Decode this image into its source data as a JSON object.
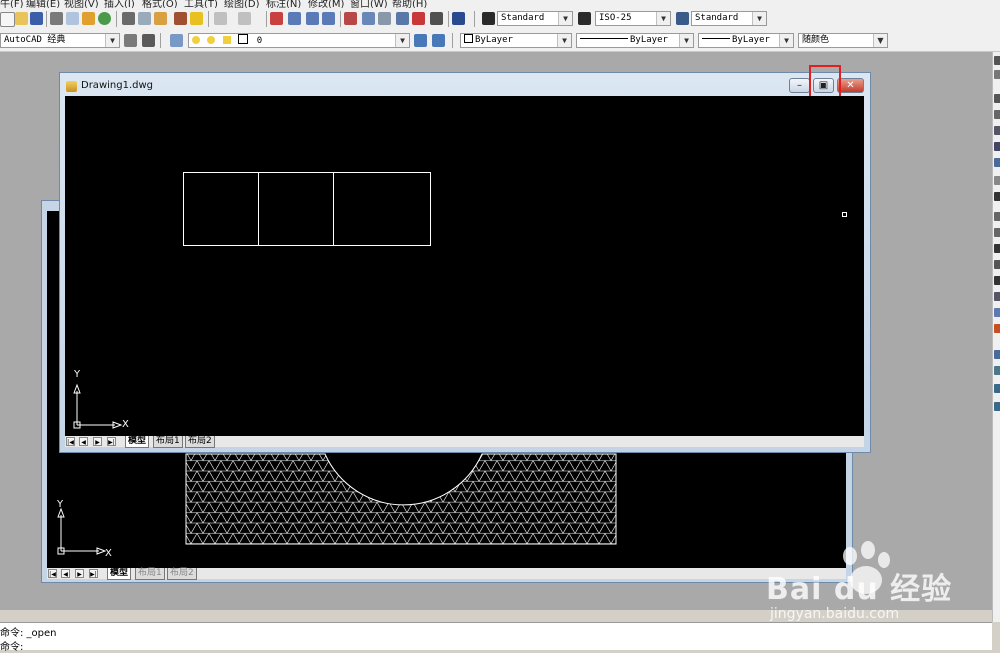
{
  "menu": {
    "items": [
      {
        "label": "牛(F)"
      },
      {
        "label": "编辑(E)"
      },
      {
        "label": "视图(V)"
      },
      {
        "label": "插入(I)"
      },
      {
        "label": "格式(O)"
      },
      {
        "label": "工具(T)"
      },
      {
        "label": "绘图(D)"
      },
      {
        "label": "标注(N)"
      },
      {
        "label": "修改(M)"
      },
      {
        "label": "窗口(W)"
      },
      {
        "label": "帮助(H)"
      }
    ]
  },
  "toolbar1": {
    "text_style": "Standard",
    "dim_style": "ISO-25",
    "table_style": "Standard"
  },
  "toolbar2": {
    "workspace": "AutoCAD 经典",
    "layer": "0",
    "color": "ByLayer",
    "linetype": "ByLayer",
    "lineweight": "ByLayer",
    "plotstyle": "随颜色"
  },
  "front_window": {
    "title": "Drawing1.dwg",
    "tabs": [
      "模型",
      "布局1",
      "布局2"
    ],
    "ucs_x": "X",
    "ucs_y": "Y",
    "btn_min": "–",
    "btn_restore": "▣",
    "btn_close": "✕"
  },
  "back_window": {
    "tabs": [
      "模型",
      "布局1",
      "布局2"
    ],
    "ucs_x": "X",
    "ucs_y": "Y"
  },
  "command": {
    "line1": "命令: _open",
    "line2": "命令:"
  },
  "watermark": {
    "brand": "Bai du 经验",
    "url": "jingyan.baidu.com"
  },
  "colors": {
    "highlight": "#e02020",
    "canvas": "#000000",
    "mdi_background": "#a9a9a9"
  }
}
